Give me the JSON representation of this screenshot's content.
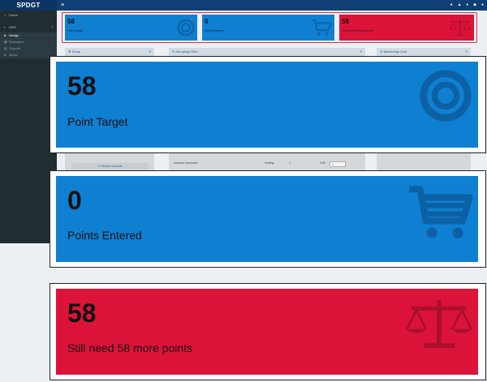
{
  "app": {
    "title": "SPDGT",
    "toggle_glyph": "≡",
    "top_icons": [
      "help-icon",
      "home-icon",
      "pin-icon",
      "rss-icon",
      "github-icon"
    ]
  },
  "sidebar": {
    "home": {
      "label": "Home",
      "icon": "home-icon"
    },
    "dms": {
      "label": "DMS",
      "icon": "folder-icon",
      "caret": "‹"
    },
    "submenu": [
      {
        "label": "Design",
        "icon": "design-icon",
        "active": true
      },
      {
        "label": "Estimation",
        "icon": "calculator-icon",
        "active": false
      },
      {
        "label": "Outputs",
        "icon": "chart-icon",
        "active": false
      },
      {
        "label": "About",
        "icon": "info-icon",
        "active": false
      }
    ]
  },
  "value_boxes": [
    {
      "id": "point-target",
      "value": "58",
      "label": "Point Target",
      "icon": "bullseye-icon",
      "color": "#0f7fd1"
    },
    {
      "id": "points-entered",
      "value": "0",
      "label": "Points Entered",
      "icon": "cart-icon",
      "color": "#0f7fd1"
    },
    {
      "id": "still-need",
      "value": "58",
      "label": "Still need 58 more points",
      "icon": "balance-scale-icon",
      "color": "#dc1339"
    }
  ],
  "panels": {
    "setup": {
      "title": "Setup",
      "help": "?"
    },
    "sampling": {
      "title": "Sampling Effort",
      "help": "?"
    },
    "monitoring": {
      "title": "Monitoring Goal",
      "help": "?"
    }
  },
  "background_peek": {
    "restore_button": "Restore Defaults",
    "row_label": "Incomes harvested",
    "row_col2": "hunting",
    "row_col3": "7",
    "row_col4": "0.65",
    "row_input": "0"
  },
  "colors": {
    "topbar": "#0f3f74",
    "sidebar": "#222d32",
    "blue": "#0f7fd1",
    "red": "#dc1339",
    "highlight_border": "#dd2a52"
  }
}
